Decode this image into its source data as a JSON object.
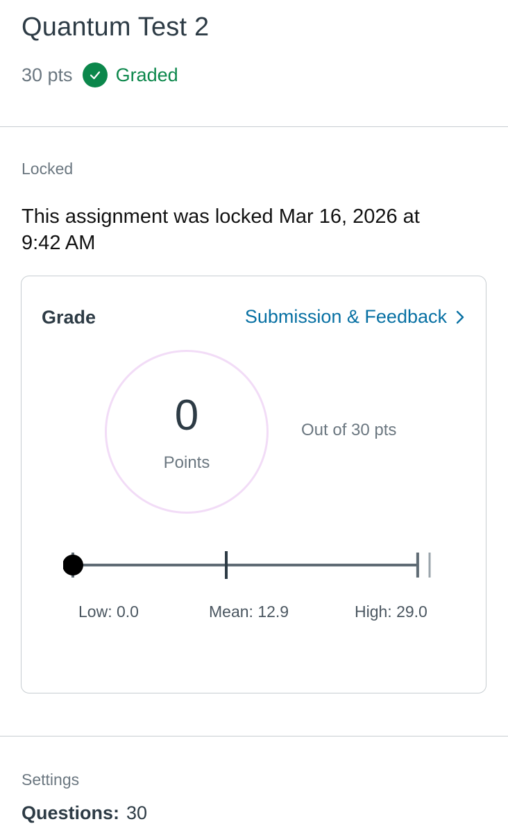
{
  "assignment": {
    "title": "Quantum Test 2",
    "points": "30 pts",
    "status": "Graded",
    "status_icon": "check-circle-icon",
    "status_color": "#0b874b"
  },
  "lock": {
    "label": "Locked",
    "message": "This assignment was locked Mar 16, 2026 at 9:42 AM"
  },
  "grade": {
    "label": "Grade",
    "link_label": "Submission & Feedback",
    "link_icon": "chevron-right-icon",
    "link_color": "#0770a3",
    "score": "0",
    "score_unit": "Points",
    "out_of": "Out of 30 pts",
    "distribution": {
      "min": 0,
      "max": 30,
      "student_score": 0,
      "low": 0.0,
      "mean": 12.9,
      "high": 29.0,
      "low_label": "Low: 0.0",
      "mean_label": "Mean: 12.9",
      "high_label": "High: 29.0"
    }
  },
  "settings": {
    "label": "Settings",
    "questions_label": "Questions:",
    "questions_value": "30"
  }
}
